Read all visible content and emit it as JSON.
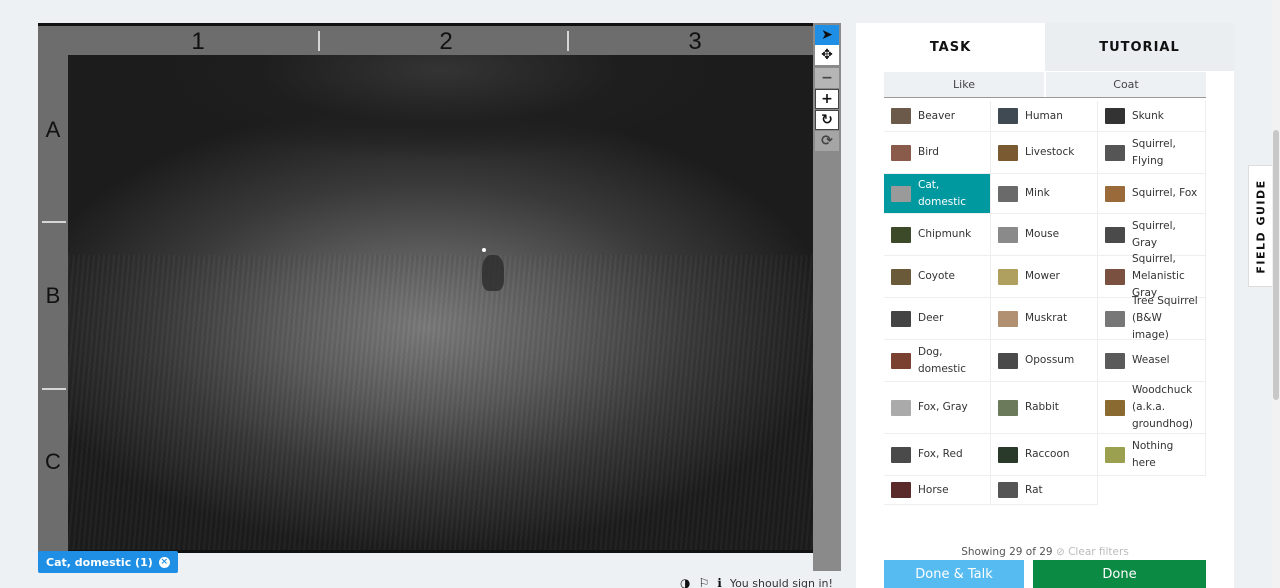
{
  "viewer": {
    "columns": [
      "1",
      "2",
      "3"
    ],
    "rows": [
      "A",
      "B",
      "C"
    ]
  },
  "tools": {
    "pointer": "➤",
    "move": "✥",
    "zoom_out": "−",
    "zoom_in": "+",
    "rotate": "↻",
    "reset": "⟳"
  },
  "selection_chip": {
    "label": "Cat, domestic (1)",
    "remove": "×"
  },
  "bottom_bar": {
    "invert_icon": "◑",
    "flag_icon": "⚐",
    "info_icon": "ℹ",
    "sign_in": "You should sign in!"
  },
  "tabs": {
    "task": "TASK",
    "tutorial": "TUTORIAL"
  },
  "filters": {
    "like": "Like",
    "coat": "Coat"
  },
  "species": [
    {
      "label": "Beaver",
      "color": "#6b5a4a"
    },
    {
      "label": "Human",
      "color": "#3f4a52"
    },
    {
      "label": "Skunk",
      "color": "#333333"
    },
    {
      "label": "Bird",
      "color": "#8a5a4a"
    },
    {
      "label": "Livestock",
      "color": "#7a5a30"
    },
    {
      "label": "Squirrel, Flying",
      "color": "#555555"
    },
    {
      "label": "Cat, domestic",
      "color": "#9a9a9a"
    },
    {
      "label": "Mink",
      "color": "#6a6a6a"
    },
    {
      "label": "Squirrel, Fox",
      "color": "#9a6a3a"
    },
    {
      "label": "Chipmunk",
      "color": "#3c4a2a"
    },
    {
      "label": "Mouse",
      "color": "#8a8a8a"
    },
    {
      "label": "Squirrel, Gray",
      "color": "#4a4a4a"
    },
    {
      "label": "Coyote",
      "color": "#6a5a3a"
    },
    {
      "label": "Mower",
      "color": "#b0a060"
    },
    {
      "label": "Squirrel, Melanistic Gray",
      "color": "#7a5040"
    },
    {
      "label": "Deer",
      "color": "#444444"
    },
    {
      "label": "Muskrat",
      "color": "#b09070"
    },
    {
      "label": "Tree Squirrel (B&W image)",
      "color": "#777777"
    },
    {
      "label": "Dog, domestic",
      "color": "#7a4030"
    },
    {
      "label": "Opossum",
      "color": "#4a4a4a"
    },
    {
      "label": "Weasel",
      "color": "#5a5a5a"
    },
    {
      "label": "Fox, Gray",
      "color": "#aaaaaa"
    },
    {
      "label": "Rabbit",
      "color": "#6a7a5a"
    },
    {
      "label": "Woodchuck (a.k.a. groundhog)",
      "color": "#8a6a30"
    },
    {
      "label": "Fox, Red",
      "color": "#4a4a4a"
    },
    {
      "label": "Raccoon",
      "color": "#2a3a2a"
    },
    {
      "label": "Nothing here",
      "color": "#9aa050"
    },
    {
      "label": "Horse",
      "color": "#5a2a2a"
    },
    {
      "label": "Rat",
      "color": "#555555"
    }
  ],
  "selected_species": "Cat, domestic",
  "showing": {
    "text": "Showing 29 of 29",
    "clear": "⊘ Clear filters"
  },
  "buttons": {
    "done_talk": "Done & Talk",
    "done": "Done"
  },
  "field_guide": "FIELD GUIDE",
  "colors": {
    "accent_blue": "#1f8fe5",
    "selected_teal": "#0099a0",
    "done_green": "#0b8a44",
    "talk_blue": "#56bbf0"
  }
}
